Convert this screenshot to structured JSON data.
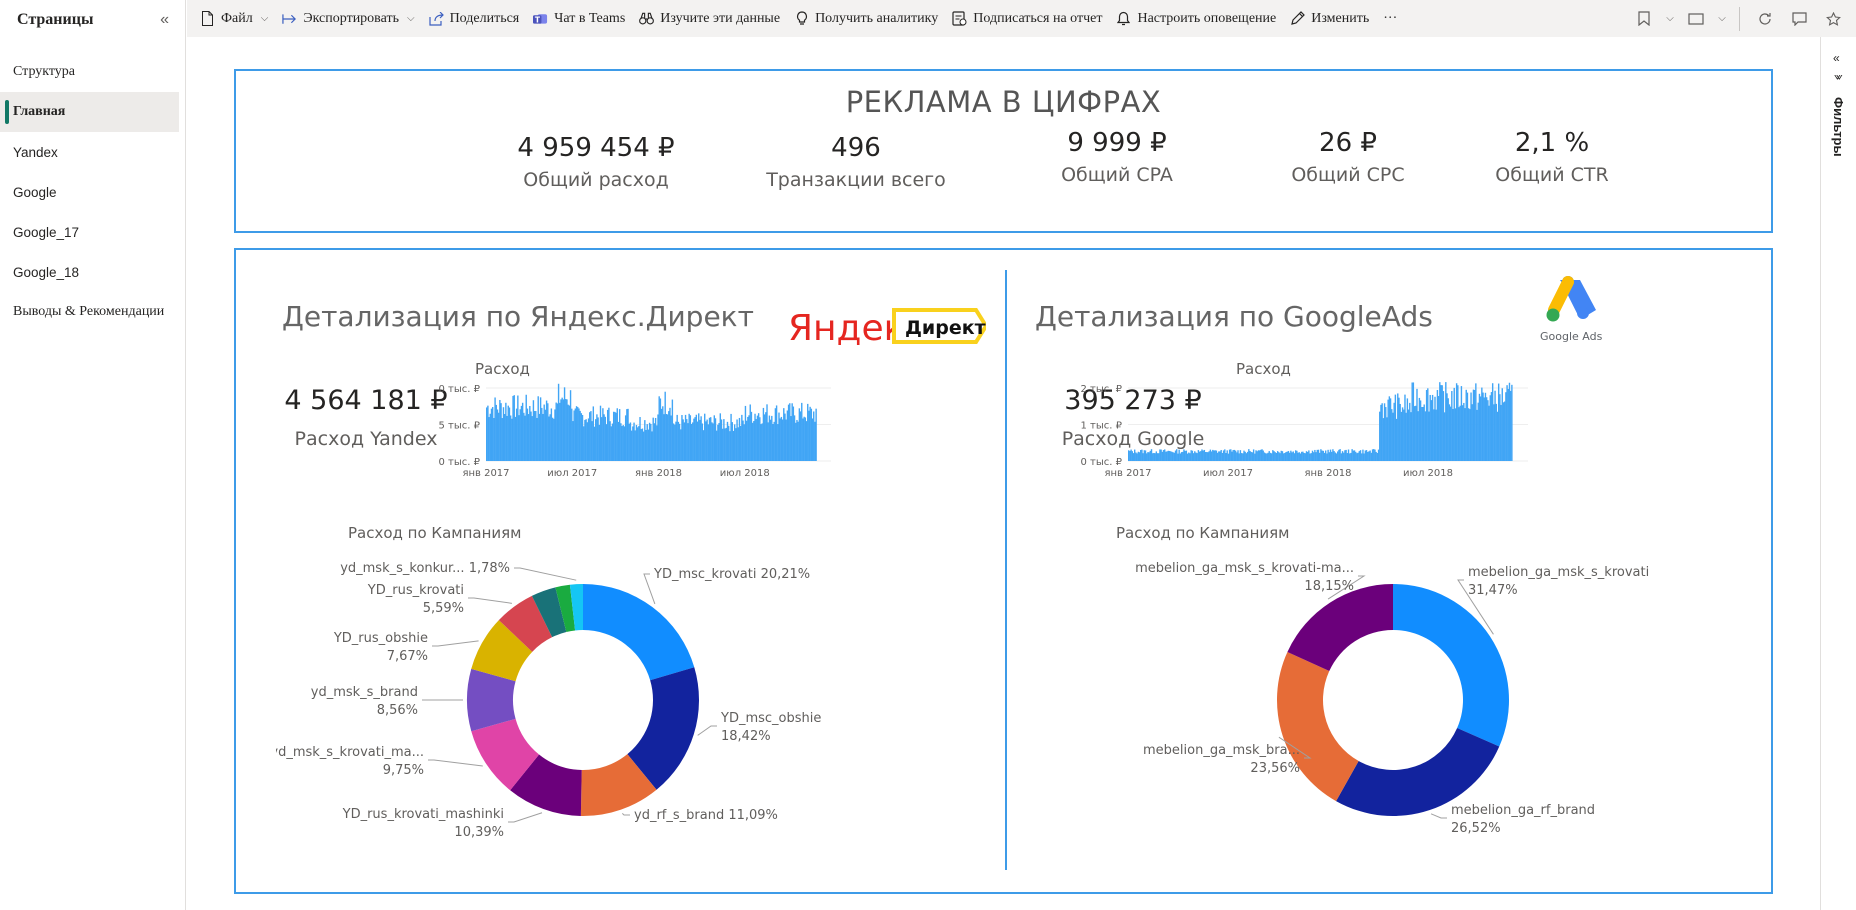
{
  "sidebar": {
    "title": "Страницы",
    "pages": [
      {
        "label": "Структура",
        "active": false
      },
      {
        "label": "Главная",
        "active": true
      },
      {
        "label": "Yandex",
        "active": false
      },
      {
        "label": "Google",
        "active": false
      },
      {
        "label": "Google_17",
        "active": false
      },
      {
        "label": "Google_18",
        "active": false
      },
      {
        "label": "Выводы & Рекомендации",
        "active": false
      }
    ]
  },
  "toolbar": {
    "file": "Файл",
    "export": "Экспортировать",
    "share": "Поделиться",
    "teams": "Чат в Teams",
    "explore": "Изучите эти данные",
    "insights": "Получить аналитику",
    "subscribe": "Подписаться на отчет",
    "alert": "Настроить оповещение",
    "edit": "Изменить",
    "more": "···"
  },
  "filters": {
    "label": "Фильтры"
  },
  "kpi": {
    "title": "РЕКЛАМА В ЦИФРАХ",
    "items": [
      {
        "value": "4 959 454 ₽",
        "label": "Общий расход"
      },
      {
        "value": "496",
        "label": "Транзакции всего"
      },
      {
        "value": "9 999 ₽",
        "label": "Общий CPA"
      },
      {
        "value": "26 ₽",
        "label": "Общий CPC"
      },
      {
        "value": "2,1 %",
        "label": "Общий CTR"
      }
    ]
  },
  "yandex": {
    "title": "Детализация по Яндекс.Директ",
    "logo_text": "Яндекс",
    "logo_badge": "Директ",
    "total_value": "4 564 181 ₽",
    "total_label": "Расход Yandex",
    "spend_title": "Расход",
    "donut_title": "Расход по Кампаниям"
  },
  "google": {
    "title": "Детализация по GoogleAds",
    "logo_caption": "Google Ads",
    "total_value": "395 273 ₽",
    "total_label": "Расход Google",
    "spend_title": "Расход",
    "donut_title": "Расход по Кампаниям"
  },
  "chart_data": [
    {
      "type": "area",
      "name": "yandex_spend",
      "title": "Расход",
      "x_ticks": [
        "янв 2017",
        "июл 2017",
        "янв 2018",
        "июл 2018"
      ],
      "y_ticks": [
        "0 тыс. ₽",
        "5 тыс. ₽",
        "10 тыс. ₽"
      ],
      "ylim": [
        0,
        10000
      ],
      "segments": [
        {
          "from": "2017-01",
          "to": "2017-06",
          "level": 7800
        },
        {
          "from": "2017-06",
          "to": "2017-07",
          "level": 9200
        },
        {
          "from": "2017-07",
          "to": "2017-11",
          "level": 6500
        },
        {
          "from": "2017-11",
          "to": "2018-01",
          "level": 5600
        },
        {
          "from": "2018-01",
          "to": "2018-02",
          "level": 8500
        },
        {
          "from": "2018-02",
          "to": "2018-07",
          "level": 5600
        },
        {
          "from": "2018-07",
          "to": "2018-12",
          "level": 6900
        }
      ],
      "color": "#41a5f5"
    },
    {
      "type": "area",
      "name": "google_spend",
      "title": "Расход",
      "x_ticks": [
        "янв 2017",
        "июл 2017",
        "янв 2018",
        "июл 2018"
      ],
      "y_ticks": [
        "0 тыс. ₽",
        "1 тыс. ₽",
        "2 тыс. ₽"
      ],
      "ylim": [
        0,
        2000
      ],
      "segments": [
        {
          "from": "2017-01",
          "to": "2018-04",
          "level": 280
        },
        {
          "from": "2018-04",
          "to": "2018-06",
          "level": 1600
        },
        {
          "from": "2018-06",
          "to": "2018-12",
          "level": 1850
        }
      ],
      "color": "#41a5f5"
    },
    {
      "type": "pie",
      "name": "yandex_campaigns",
      "title": "Расход по Кампаниям",
      "slices": [
        {
          "label": "YD_msc_krovati",
          "pct": "20,21%",
          "value": 20.21,
          "color": "#118dff"
        },
        {
          "label": "YD_msc_obshie",
          "pct": "18,42%",
          "value": 18.42,
          "color": "#12239e"
        },
        {
          "label": "yd_rf_s_brand",
          "pct": "11,09%",
          "value": 11.09,
          "color": "#e66c37"
        },
        {
          "label": "YD_rus_krovati_mashinki",
          "pct": "10,39%",
          "value": 10.39,
          "color": "#6b007b"
        },
        {
          "label": "yd_msk_s_krovati_ma...",
          "pct": "9,75%",
          "value": 9.75,
          "color": "#e044a7"
        },
        {
          "label": "yd_msk_s_brand",
          "pct": "8,56%",
          "value": 8.56,
          "color": "#744ec2"
        },
        {
          "label": "YD_rus_obshie",
          "pct": "7,67%",
          "value": 7.67,
          "color": "#d9b300"
        },
        {
          "label": "YD_rus_krovati",
          "pct": "5,59%",
          "value": 5.59,
          "color": "#d64550"
        },
        {
          "label": "",
          "pct": "",
          "value": 3.4,
          "color": "#197278"
        },
        {
          "label": "",
          "pct": "",
          "value": 2.0,
          "color": "#1aab40"
        },
        {
          "label": "yd_msk_s_konkur...",
          "pct": "1,78%",
          "value": 1.78,
          "color": "#15c6f4"
        }
      ]
    },
    {
      "type": "pie",
      "name": "google_campaigns",
      "title": "Расход по Кампаниям",
      "slices": [
        {
          "label": "mebelion_ga_msk_s_krovati",
          "pct": "31,47%",
          "value": 31.47,
          "color": "#118dff"
        },
        {
          "label": "mebelion_ga_rf_brand",
          "pct": "26,52%",
          "value": 26.52,
          "color": "#12239e"
        },
        {
          "label": "mebelion_ga_msk_bra...",
          "pct": "23,56%",
          "value": 23.56,
          "color": "#e66c37"
        },
        {
          "label": "mebelion_ga_msk_s_krovati-ma...",
          "pct": "18,15%",
          "value": 18.15,
          "color": "#6b007b"
        }
      ]
    }
  ]
}
